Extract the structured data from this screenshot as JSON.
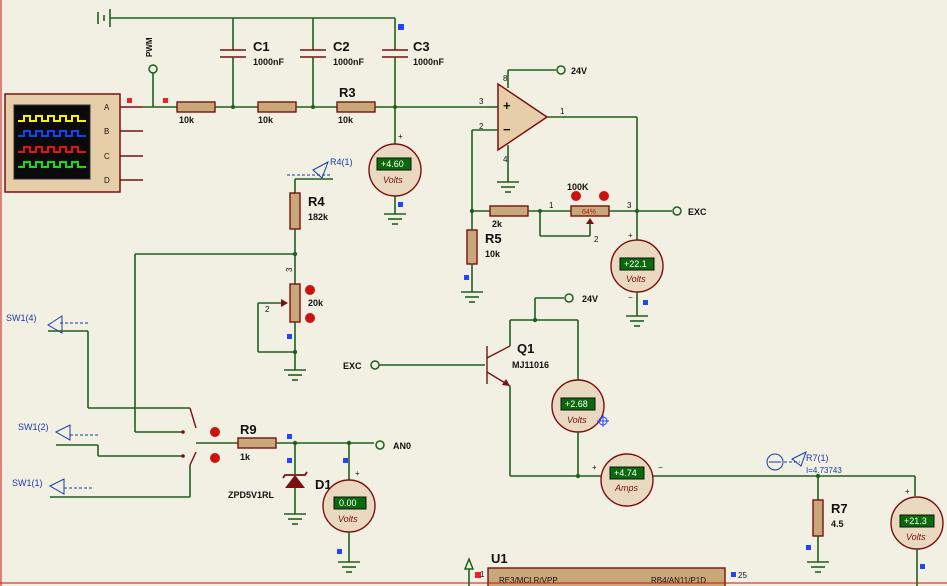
{
  "labels": {
    "pwm": "PWM",
    "c1": "C1",
    "c1v": "1000nF",
    "c2": "C2",
    "c2v": "1000nF",
    "c3": "C3",
    "c3v": "1000nF",
    "r_a": "10k",
    "r_b": "10k",
    "r3": "R3",
    "r3v": "10k",
    "v24_top": "24V",
    "r4": "R4",
    "r4v": "182k",
    "r4probe": "R4(1)",
    "pot20k": "20k",
    "r5": "R5",
    "r5v": "10k",
    "r2k": "2k",
    "pot100k": "100K",
    "pot64": "64%",
    "exc_out": "EXC",
    "v24_mid": "24V",
    "q1": "Q1",
    "q1v": "MJ11016",
    "exc_in": "EXC",
    "sw1_4": "SW1(4)",
    "sw1_2": "SW1(2)",
    "sw1_1": "SW1(1)",
    "r9": "R9",
    "r9v": "1k",
    "an0": "AN0",
    "d1": "D1",
    "d1v": "ZPD5V1RL",
    "r7": "R7",
    "r7v": "4.5",
    "r7probe": "R7(1)",
    "r7current": "I=4.73743",
    "u1": "U1",
    "u1pin1": "RE3/MCLR/VPP",
    "u1pin2": "RB4/AN11/P1D",
    "u1pin25": "25",
    "u1pinnum1": "1",
    "osc_a": "A",
    "osc_b": "B",
    "osc_c": "C",
    "osc_d": "D",
    "pin3": "3",
    "pin2": "2",
    "pin1": "1",
    "pin8": "8",
    "pin4": "4",
    "potpin1": "1",
    "potpin2": "2",
    "potpin3": "3",
    "pot20pin3": "3",
    "pot20pin2": "2"
  },
  "meters": {
    "vm1": {
      "value": "+4.60",
      "unit": "Volts"
    },
    "vm2": {
      "value": "+22.1",
      "unit": "Volts"
    },
    "vm3": {
      "value": "+2.68",
      "unit": "Volts"
    },
    "am1": {
      "value": "+4.74",
      "unit": "Amps"
    },
    "vm4": {
      "value": "0.00",
      "unit": "Volts"
    },
    "vm5": {
      "value": "+21.3",
      "unit": "Volts"
    }
  },
  "colors": {
    "wire": "#1f5f1f",
    "component": "#7a1010",
    "background": "#f2f0e2",
    "meter_display": "#0a6a0a",
    "probe_text": "#1a3aa8"
  }
}
